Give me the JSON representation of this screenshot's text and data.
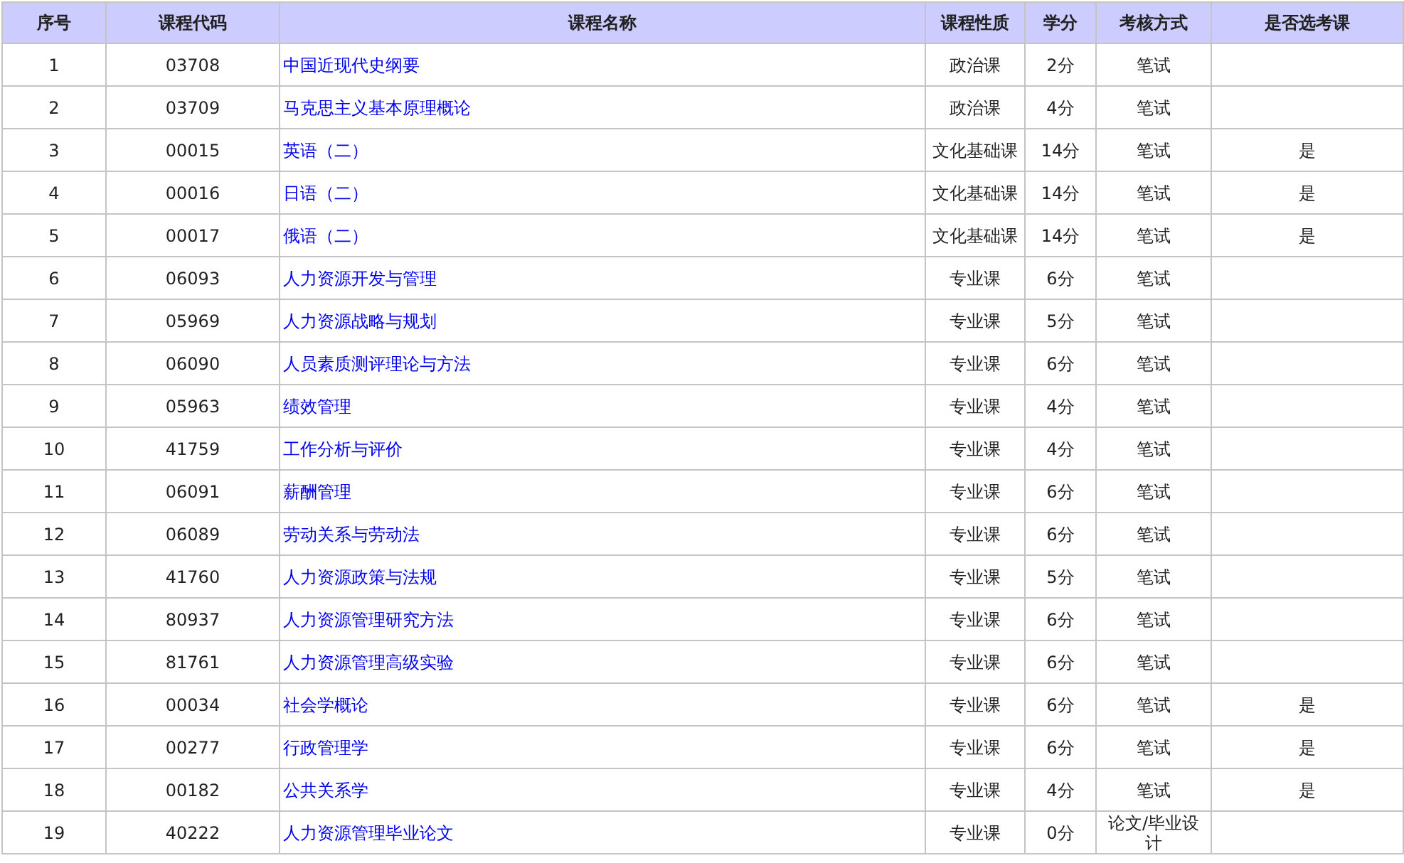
{
  "table": {
    "columns": [
      "序号",
      "课程代码",
      "课程名称",
      "课程性质",
      "学分",
      "考核方式",
      "是否选考课"
    ],
    "rows": [
      {
        "no": "1",
        "code": "03708",
        "name": "中国近现代史纲要",
        "type": "政治课",
        "credit": "2分",
        "exam": "笔试"
      },
      {
        "no": "2",
        "code": "03709",
        "name": "马克思主义基本原理概论",
        "type": "政治课",
        "credit": "4分",
        "exam": "笔试"
      },
      {
        "no": "3",
        "code": "00015",
        "name": "英语（二）",
        "type": "文化基础课",
        "credit": "14分",
        "exam": "笔试",
        "elective": "是"
      },
      {
        "no": "4",
        "code": "00016",
        "name": "日语（二）",
        "type": "文化基础课",
        "credit": "14分",
        "exam": "笔试",
        "elective": "是"
      },
      {
        "no": "5",
        "code": "00017",
        "name": "俄语（二）",
        "type": "文化基础课",
        "credit": "14分",
        "exam": "笔试",
        "elective": "是"
      },
      {
        "no": "6",
        "code": "06093",
        "name": "人力资源开发与管理",
        "type": "专业课",
        "credit": "6分",
        "exam": "笔试"
      },
      {
        "no": "7",
        "code": "05969",
        "name": "人力资源战略与规划",
        "type": "专业课",
        "credit": "5分",
        "exam": "笔试"
      },
      {
        "no": "8",
        "code": "06090",
        "name": "人员素质测评理论与方法",
        "type": "专业课",
        "credit": "6分",
        "exam": "笔试"
      },
      {
        "no": "9",
        "code": "05963",
        "name": "绩效管理",
        "type": "专业课",
        "credit": "4分",
        "exam": "笔试"
      },
      {
        "no": "10",
        "code": "41759",
        "name": "工作分析与评价",
        "type": "专业课",
        "credit": "4分",
        "exam": "笔试"
      },
      {
        "no": "11",
        "code": "06091",
        "name": "薪酬管理",
        "type": "专业课",
        "credit": "6分",
        "exam": "笔试"
      },
      {
        "no": "12",
        "code": "06089",
        "name": "劳动关系与劳动法",
        "type": "专业课",
        "credit": "6分",
        "exam": "笔试"
      },
      {
        "no": "13",
        "code": "41760",
        "name": "人力资源政策与法规",
        "type": "专业课",
        "credit": "5分",
        "exam": "笔试"
      },
      {
        "no": "14",
        "code": "80937",
        "name": "人力资源管理研究方法",
        "type": "专业课",
        "credit": "6分",
        "exam": "笔试"
      },
      {
        "no": "15",
        "code": "81761",
        "name": "人力资源管理高级实验",
        "type": "专业课",
        "credit": "6分",
        "exam": "笔试"
      },
      {
        "no": "16",
        "code": "00034",
        "name": "社会学概论",
        "type": "专业课",
        "credit": "6分",
        "exam": "笔试",
        "elective": "是"
      },
      {
        "no": "17",
        "code": "00277",
        "name": "行政管理学",
        "type": "专业课",
        "credit": "6分",
        "exam": "笔试",
        "elective": "是"
      },
      {
        "no": "18",
        "code": "00182",
        "name": "公共关系学",
        "type": "专业课",
        "credit": "4分",
        "exam": "笔试",
        "elective": "是"
      },
      {
        "no": "19",
        "code": "40222",
        "name": "人力资源管理毕业论文",
        "type": "专业课",
        "credit": "0分",
        "exam": "论文/毕业设计"
      }
    ]
  }
}
